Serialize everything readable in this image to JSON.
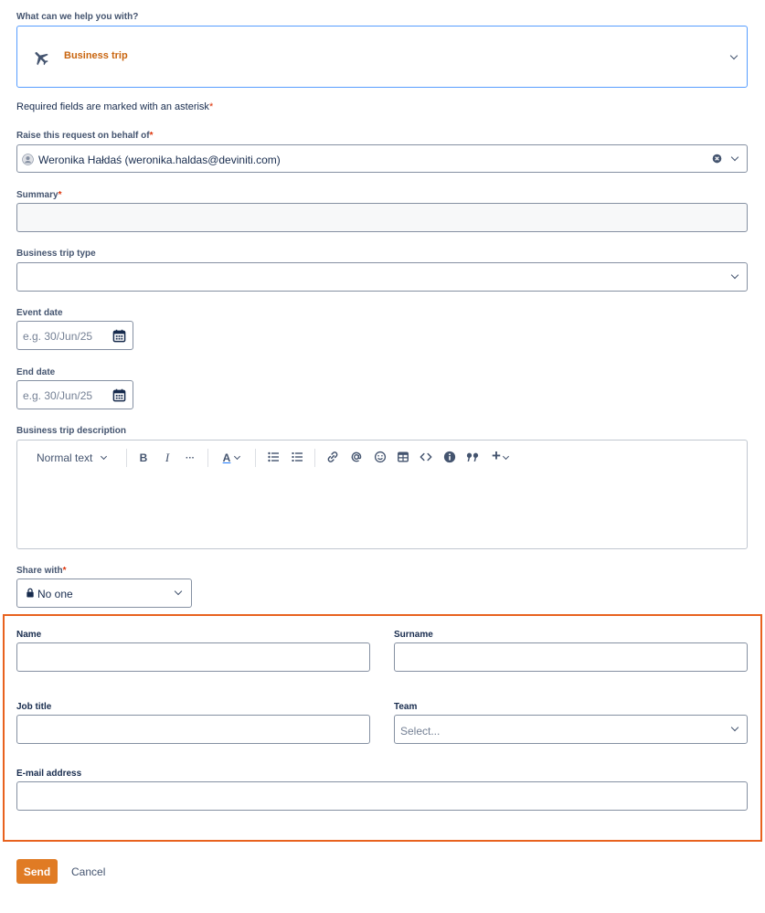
{
  "request_type": {
    "label": "What can we help you with?",
    "value": "Business trip",
    "icon": "airplane-icon"
  },
  "required_note": "Required fields are marked with an asterisk",
  "asterisk": "*",
  "behalf": {
    "label": "Raise this request on behalf of",
    "value": "Weronika Hałdaś (weronika.haldas@deviniti.com)"
  },
  "summary": {
    "label": "Summary",
    "value": ""
  },
  "trip_type": {
    "label": "Business trip type",
    "value": ""
  },
  "event_date": {
    "label": "Event date",
    "placeholder": "e.g. 30/Jun/25"
  },
  "end_date": {
    "label": "End date",
    "placeholder": "e.g. 30/Jun/25"
  },
  "description": {
    "label": "Business trip description",
    "toolbar": {
      "text_style": "Normal text",
      "bold": "B",
      "italic": "I",
      "more": "···",
      "text_color": "A",
      "insert": "+"
    }
  },
  "share_with": {
    "label": "Share with",
    "value": "No one"
  },
  "contact": {
    "name_label": "Name",
    "surname_label": "Surname",
    "job_title_label": "Job title",
    "team_label": "Team",
    "team_placeholder": "Select...",
    "email_label": "E-mail address"
  },
  "buttons": {
    "send": "Send",
    "cancel": "Cancel"
  },
  "colors": {
    "accent": "#e07b24",
    "highlight": "#e8621e",
    "focus": "#579dff",
    "required": "#de350b",
    "text": "#172b4d"
  }
}
